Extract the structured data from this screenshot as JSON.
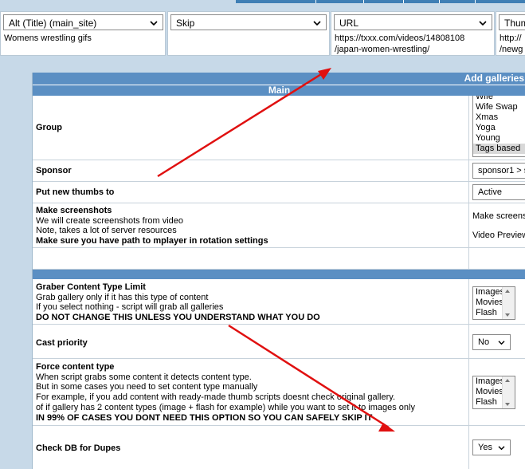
{
  "mapping": {
    "columns": [
      {
        "select": "Alt (Title) (main_site)",
        "value_lines": [
          "Womens wrestling gifs"
        ]
      },
      {
        "select": "Skip",
        "value_lines": []
      },
      {
        "select": "URL",
        "value_lines": [
          "https://txxx.com/videos/14808108",
          "/japan-women-wrestling/"
        ]
      },
      {
        "select": "Thum",
        "value_lines": [
          "http://",
          "/newg"
        ]
      }
    ]
  },
  "panel": {
    "title": "Add galleries",
    "section_main": "Main"
  },
  "rows": {
    "group": {
      "label": "Group",
      "options": [
        "Wife",
        "Wife Swap",
        "Xmas",
        "Yoga",
        "Young",
        "Tags based"
      ],
      "selected": "Tags based"
    },
    "sponsor": {
      "label": "Sponsor",
      "value": "sponsor1 > s"
    },
    "put_thumbs": {
      "label": "Put new thumbs to",
      "value": "Active"
    },
    "screenshots": {
      "title": "Make screenshots",
      "line1": "We will create screenshots from video",
      "line2": "Note, takes a lot of server resources",
      "warning": "Make sure you have path to mplayer in rotation settings",
      "opt1": "Make screensh",
      "opt2": "Video Preview"
    },
    "graber": {
      "title": "Graber Content Type Limit",
      "line1": "Grab gallery only if it has this type of content",
      "line2": "If you select nothing - script will grab all galleries",
      "warning": "DO NOT CHANGE THIS UNLESS YOU UNDERSTAND WHAT YOU DO",
      "options": [
        "Images",
        "Movies",
        "Flash"
      ]
    },
    "cast": {
      "label": "Cast priority",
      "value": "No"
    },
    "force": {
      "title": "Force content type",
      "line1": "When script grabs some content it detects content type.",
      "line2": "But in some cases you need to set content type manually",
      "line3": "For example, if you add content with ready-made thumb scripts doesnt check original gallery.",
      "line4": "of if gallery has 2 content types (image + flash for example) while you want to set it to images only",
      "warning": "IN 99% OF CASES YOU DONT NEED THIS OPTION SO YOU CAN SAFELY SKIP IT",
      "options": [
        "Images",
        "Movies",
        "Flash"
      ]
    },
    "dupes": {
      "label": "Check DB for Dupes",
      "value": "Yes"
    }
  },
  "colors": {
    "background": "#c7d9e8",
    "header_blue": "#5b8fc3",
    "annotation_arrow": "#e01010"
  },
  "icons": {
    "select_arrow": "chevron-down-icon",
    "scroll_up": "scroll-up-arrow-icon",
    "scroll_down": "scroll-down-arrow-icon"
  }
}
